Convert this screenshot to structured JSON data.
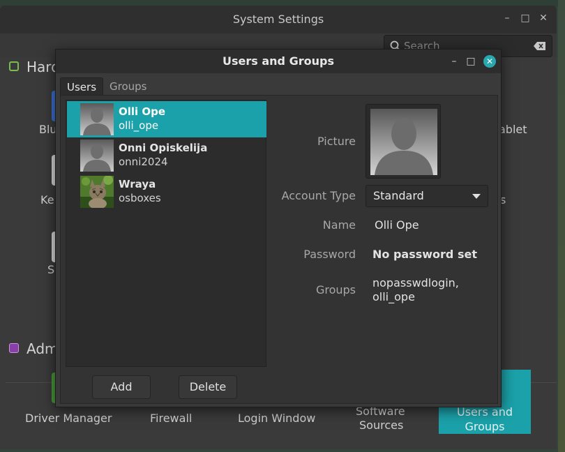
{
  "system_settings": {
    "title": "System Settings",
    "search": {
      "placeholder": "Search"
    },
    "sections": {
      "hardware_partial": "Hard",
      "administration_partial": "Adm"
    },
    "partial_labels": {
      "blu": "Blu",
      "ke": "Ke",
      "s": "S",
      "tablet": "ablet",
      "s_right": "s",
      "software_sources_top": "Software",
      "software_sources_bottom": "Sources"
    },
    "admin_items": [
      "Driver Manager",
      "Firewall",
      "Login Window"
    ],
    "selected_tile": {
      "line1": "Users and",
      "line2": "Groups"
    }
  },
  "dialog": {
    "title": "Users and Groups",
    "tabs": [
      "Users",
      "Groups"
    ],
    "users": [
      {
        "name": "Olli Ope",
        "login": "olli_ope",
        "avatar": "silhouette-avatar",
        "selected": true
      },
      {
        "name": "Onni Opiskelija",
        "login": "onni2024",
        "avatar": "silhouette-avatar",
        "selected": false
      },
      {
        "name": "Wraya",
        "login": "osboxes",
        "avatar": "kitten-photo-avatar",
        "selected": false
      }
    ],
    "buttons": {
      "add": "Add",
      "delete": "Delete"
    },
    "details": {
      "picture_label": "Picture",
      "account_type_label": "Account Type",
      "account_type_value": "Standard",
      "name_label": "Name",
      "name_value": "Olli Ope",
      "password_label": "Password",
      "password_value": "No password set",
      "groups_label": "Groups",
      "groups_line1": "nopasswdlogin,",
      "groups_line2": "olli_ope"
    }
  },
  "colors": {
    "accent": "#1ba1a9",
    "close_button": "#2aa8b0",
    "window_bg": "#3a3a3a",
    "titlebar_bg": "#2d2d2d"
  }
}
